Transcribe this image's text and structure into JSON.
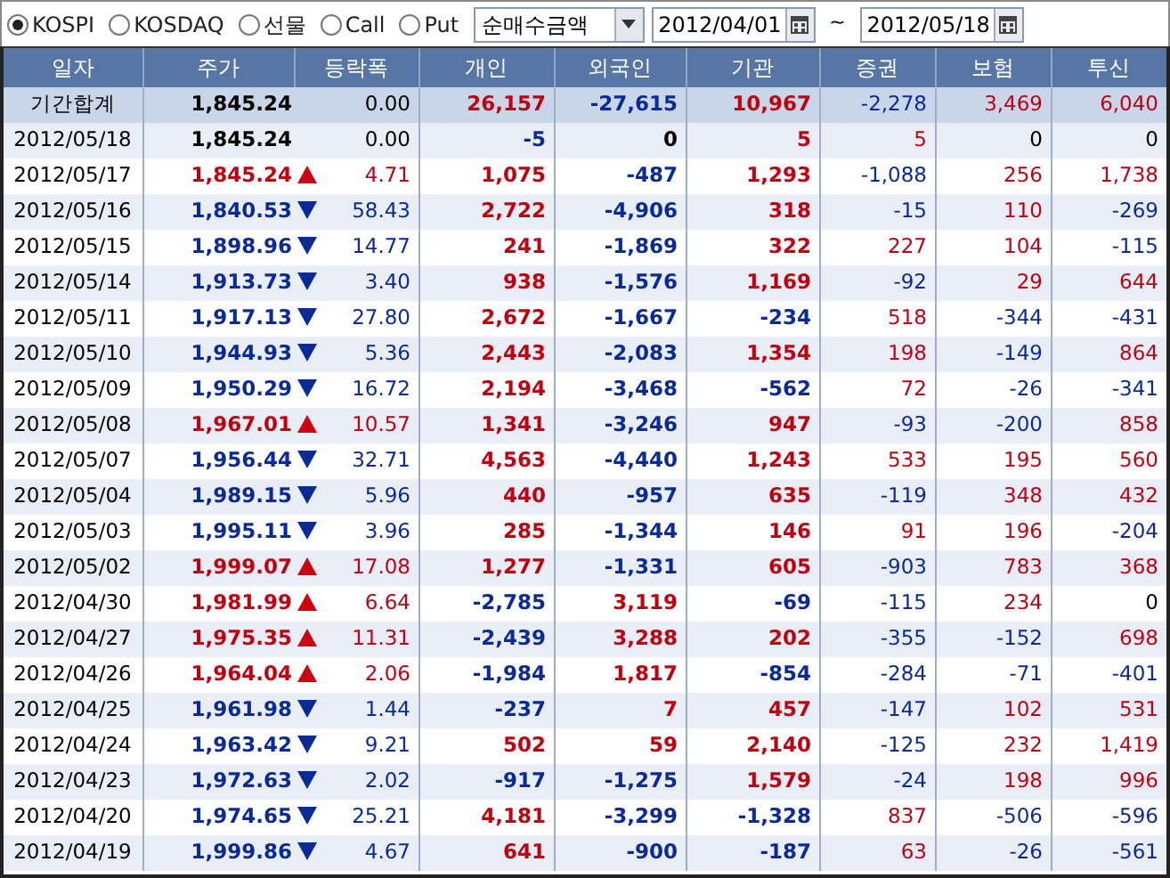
{
  "toolbar": {
    "markets": [
      {
        "label": "KOSPI",
        "selected": true
      },
      {
        "label": "KOSDAQ",
        "selected": false
      },
      {
        "label": "선물",
        "selected": false
      },
      {
        "label": "Call",
        "selected": false
      },
      {
        "label": "Put",
        "selected": false
      }
    ],
    "measure": "순매수금액",
    "date_from": "2012/04/01",
    "separator": "~",
    "date_to": "2012/05/18"
  },
  "table": {
    "columns": [
      "일자",
      "주가",
      "등락폭",
      "개인",
      "외국인",
      "기관",
      "증권",
      "보험",
      "투신"
    ],
    "rows": [
      {
        "kind": "total",
        "date": "기간합계",
        "price": "1,845.24",
        "up": false,
        "down": false,
        "change": "0.00",
        "individual": "26,157",
        "foreign": "-27,615",
        "institution": "10,967",
        "securities": "-2,278",
        "insurance": "3,469",
        "trust": "6,040"
      },
      {
        "kind": "day",
        "date": "2012/05/18",
        "price": "1,845.24",
        "up": false,
        "down": false,
        "change": "0.00",
        "individual": "-5",
        "foreign": "0",
        "institution": "5",
        "securities": "5",
        "insurance": "0",
        "trust": "0"
      },
      {
        "kind": "day",
        "date": "2012/05/17",
        "price": "1,845.24",
        "up": true,
        "down": false,
        "change": "4.71",
        "individual": "1,075",
        "foreign": "-487",
        "institution": "1,293",
        "securities": "-1,088",
        "insurance": "256",
        "trust": "1,738"
      },
      {
        "kind": "day",
        "date": "2012/05/16",
        "price": "1,840.53",
        "up": false,
        "down": true,
        "change": "58.43",
        "individual": "2,722",
        "foreign": "-4,906",
        "institution": "318",
        "securities": "-15",
        "insurance": "110",
        "trust": "-269"
      },
      {
        "kind": "day",
        "date": "2012/05/15",
        "price": "1,898.96",
        "up": false,
        "down": true,
        "change": "14.77",
        "individual": "241",
        "foreign": "-1,869",
        "institution": "322",
        "securities": "227",
        "insurance": "104",
        "trust": "-115"
      },
      {
        "kind": "day",
        "date": "2012/05/14",
        "price": "1,913.73",
        "up": false,
        "down": true,
        "change": "3.40",
        "individual": "938",
        "foreign": "-1,576",
        "institution": "1,169",
        "securities": "-92",
        "insurance": "29",
        "trust": "644"
      },
      {
        "kind": "day",
        "date": "2012/05/11",
        "price": "1,917.13",
        "up": false,
        "down": true,
        "change": "27.80",
        "individual": "2,672",
        "foreign": "-1,667",
        "institution": "-234",
        "securities": "518",
        "insurance": "-344",
        "trust": "-431"
      },
      {
        "kind": "day",
        "date": "2012/05/10",
        "price": "1,944.93",
        "up": false,
        "down": true,
        "change": "5.36",
        "individual": "2,443",
        "foreign": "-2,083",
        "institution": "1,354",
        "securities": "198",
        "insurance": "-149",
        "trust": "864"
      },
      {
        "kind": "day",
        "date": "2012/05/09",
        "price": "1,950.29",
        "up": false,
        "down": true,
        "change": "16.72",
        "individual": "2,194",
        "foreign": "-3,468",
        "institution": "-562",
        "securities": "72",
        "insurance": "-26",
        "trust": "-341"
      },
      {
        "kind": "day",
        "date": "2012/05/08",
        "price": "1,967.01",
        "up": true,
        "down": false,
        "change": "10.57",
        "individual": "1,341",
        "foreign": "-3,246",
        "institution": "947",
        "securities": "-93",
        "insurance": "-200",
        "trust": "858"
      },
      {
        "kind": "day",
        "date": "2012/05/07",
        "price": "1,956.44",
        "up": false,
        "down": true,
        "change": "32.71",
        "individual": "4,563",
        "foreign": "-4,440",
        "institution": "1,243",
        "securities": "533",
        "insurance": "195",
        "trust": "560"
      },
      {
        "kind": "day",
        "date": "2012/05/04",
        "price": "1,989.15",
        "up": false,
        "down": true,
        "change": "5.96",
        "individual": "440",
        "foreign": "-957",
        "institution": "635",
        "securities": "-119",
        "insurance": "348",
        "trust": "432"
      },
      {
        "kind": "day",
        "date": "2012/05/03",
        "price": "1,995.11",
        "up": false,
        "down": true,
        "change": "3.96",
        "individual": "285",
        "foreign": "-1,344",
        "institution": "146",
        "securities": "91",
        "insurance": "196",
        "trust": "-204"
      },
      {
        "kind": "day",
        "date": "2012/05/02",
        "price": "1,999.07",
        "up": true,
        "down": false,
        "change": "17.08",
        "individual": "1,277",
        "foreign": "-1,331",
        "institution": "605",
        "securities": "-903",
        "insurance": "783",
        "trust": "368"
      },
      {
        "kind": "day",
        "date": "2012/04/30",
        "price": "1,981.99",
        "up": true,
        "down": false,
        "change": "6.64",
        "individual": "-2,785",
        "foreign": "3,119",
        "institution": "-69",
        "securities": "-115",
        "insurance": "234",
        "trust": "0"
      },
      {
        "kind": "day",
        "date": "2012/04/27",
        "price": "1,975.35",
        "up": true,
        "down": false,
        "change": "11.31",
        "individual": "-2,439",
        "foreign": "3,288",
        "institution": "202",
        "securities": "-355",
        "insurance": "-152",
        "trust": "698"
      },
      {
        "kind": "day",
        "date": "2012/04/26",
        "price": "1,964.04",
        "up": true,
        "down": false,
        "change": "2.06",
        "individual": "-1,984",
        "foreign": "1,817",
        "institution": "-854",
        "securities": "-284",
        "insurance": "-71",
        "trust": "-401"
      },
      {
        "kind": "day",
        "date": "2012/04/25",
        "price": "1,961.98",
        "up": false,
        "down": true,
        "change": "1.44",
        "individual": "-237",
        "foreign": "7",
        "institution": "457",
        "securities": "-147",
        "insurance": "102",
        "trust": "531"
      },
      {
        "kind": "day",
        "date": "2012/04/24",
        "price": "1,963.42",
        "up": false,
        "down": true,
        "change": "9.21",
        "individual": "502",
        "foreign": "59",
        "institution": "2,140",
        "securities": "-125",
        "insurance": "232",
        "trust": "1,419"
      },
      {
        "kind": "day",
        "date": "2012/04/23",
        "price": "1,972.63",
        "up": false,
        "down": true,
        "change": "2.02",
        "individual": "-917",
        "foreign": "-1,275",
        "institution": "1,579",
        "securities": "-24",
        "insurance": "198",
        "trust": "996"
      },
      {
        "kind": "day",
        "date": "2012/04/20",
        "price": "1,974.65",
        "up": false,
        "down": true,
        "change": "25.21",
        "individual": "4,181",
        "foreign": "-3,299",
        "institution": "-1,328",
        "securities": "837",
        "insurance": "-506",
        "trust": "-596"
      },
      {
        "kind": "day",
        "date": "2012/04/19",
        "price": "1,999.86",
        "up": false,
        "down": true,
        "change": "4.67",
        "individual": "641",
        "foreign": "-900",
        "institution": "-187",
        "securities": "63",
        "insurance": "-26",
        "trust": "-561"
      }
    ]
  }
}
